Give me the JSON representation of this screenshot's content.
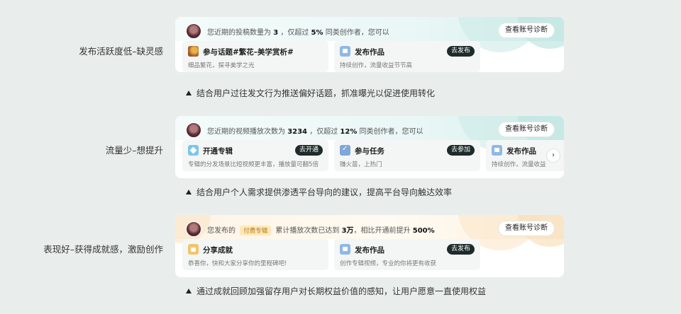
{
  "sections": [
    {
      "label": "发布活跃度低–缺灵感",
      "headline_prefix": "您近期的投稿数量为",
      "headline_value": "3",
      "headline_mid": "，仅超过",
      "headline_pct": "5%",
      "headline_suffix": "同类创作者，您可以",
      "diag_button": "查看账号诊断",
      "items": [
        {
          "title": "参与话题#繁花–美学赏析#",
          "desc": "细品繁花，探寻美学之光",
          "icon": "topic-photo-icon"
        },
        {
          "title": "发布作品",
          "desc": "持续创作，流量收益节节高",
          "action": "去发布",
          "icon": "video-icon"
        }
      ],
      "note": "结合用户过往发文行为推送偏好话题，抓准曝光以促进使用转化"
    },
    {
      "label": "流量少–想提升",
      "headline_prefix": "您近期的视频播放次数为",
      "headline_value": "3234",
      "headline_mid": "，仅超过",
      "headline_pct": "12%",
      "headline_suffix": "同类创作者，您可以",
      "diag_button": "查看账号诊断",
      "items": [
        {
          "title": "开通专辑",
          "desc": "专辑的分发场景比短视频更丰富，播放量可翻5倍",
          "action": "去开通",
          "icon": "diamond-icon"
        },
        {
          "title": "参与任务",
          "desc": "赚火苗，上热门",
          "action": "去参加",
          "icon": "task-icon"
        },
        {
          "title": "发布作品",
          "desc": "持续创作，流量收益",
          "icon": "video-icon"
        }
      ],
      "next_icon": "chevron-right-icon",
      "note": "结合用户个人需求提供渗透平台导向的建议，提高平台导向触达效率"
    },
    {
      "label": "表现好–获得成就感，激励创作",
      "headline_prefix": "您发布的",
      "tag": "付费专辑",
      "headline_mid": "累计播放次数已达到",
      "headline_value": "3万",
      "headline_mid2": "，相比开通前提升",
      "headline_pct": "500%",
      "diag_button": "查看账号诊断",
      "items": [
        {
          "title": "分享成就",
          "desc": "恭喜你，快和大家分享你的里程碑吧!",
          "icon": "thumbs-up-icon"
        },
        {
          "title": "发布作品",
          "desc": "创作专辑视频，专业的你将更有收获",
          "action": "去发布",
          "icon": "video-icon"
        }
      ],
      "note": "通过成就回顾加强留存用户对长期权益价值的感知，让用户愿意一直使用权益"
    }
  ]
}
